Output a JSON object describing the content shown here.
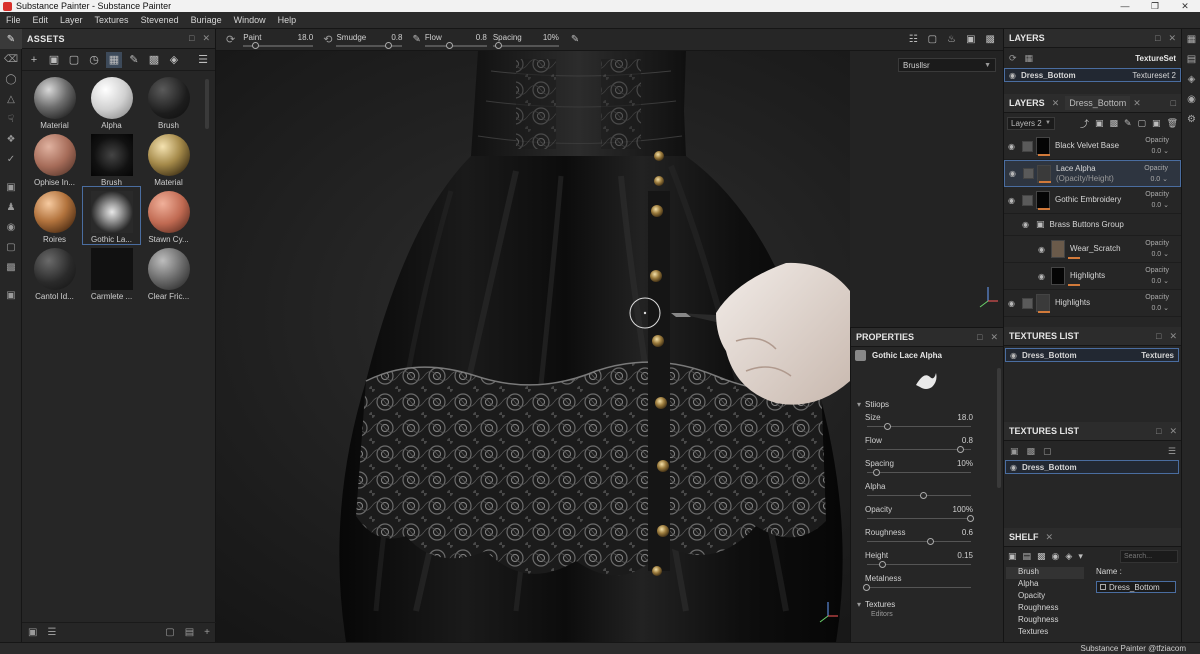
{
  "window": {
    "title": "Substance Painter - Substance Painter"
  },
  "menu": [
    "File",
    "Edit",
    "Layer",
    "Textures",
    "Stevened",
    "Buriage",
    "Window",
    "Help"
  ],
  "assets": {
    "title": "ASSETS",
    "items": [
      {
        "label": "Material",
        "style": "radial-gradient(circle at 35% 30%, #d8d8d8, #6d6d6d 45%, #2a2a2a 80%)"
      },
      {
        "label": "Alpha",
        "style": "radial-gradient(circle at 35% 30%, #ffffff, #d0d0d0 50%, #8a8a8a 90%)"
      },
      {
        "label": "Brush",
        "style": "radial-gradient(circle at 35% 30%, #5a5a5a, #1c1c1c 60%, #0d0d0d)"
      },
      {
        "label": "Ophise In...",
        "style": "radial-gradient(circle at 35% 30%, #e0b2a0, #a66c59 50%, #55352a 90%)"
      },
      {
        "label": "Brush",
        "style": "radial-gradient(circle at 50% 50%, #444, #111 60%, #050505)",
        "square": true
      },
      {
        "label": "Material",
        "style": "radial-gradient(circle at 35% 30%, #f4e2b0, #a58a4a 45%, #3c2e14 85%)"
      },
      {
        "label": "Roires",
        "style": "radial-gradient(circle at 35% 30%, #f6caa0, #b2733d 45%, #4a2a12 85%)"
      },
      {
        "label": "Gothic La...",
        "style": "radial-gradient(circle at 50% 50%, #e8e8e8, #9a9a9a 30%, #2a2a2a 70%)",
        "square": true
      },
      {
        "label": "Stawn Cy...",
        "style": "radial-gradient(circle at 35% 30%, #f0b09a, #c06a52 50%, #5a2c20 90%)"
      },
      {
        "label": "Cantol Id...",
        "style": "radial-gradient(circle at 35% 30%, #6a6a6a, #2a2a2a 55%, #111)"
      },
      {
        "label": "Carmlete ...",
        "style": "linear-gradient(#111, #111)",
        "square": true
      },
      {
        "label": "Clear Fric...",
        "style": "radial-gradient(circle at 35% 30%, #bdbdbd, #6a6a6a 50%, #2a2a2a 90%)"
      }
    ]
  },
  "tool_options": {
    "paint": {
      "label": "Paint",
      "value": "18.0",
      "level": 0.18
    },
    "smudge": {
      "label": "Smudge",
      "value": "0.8",
      "level": 0.8
    },
    "flow": {
      "label": "Flow",
      "value": "0.8",
      "level": 0.4
    },
    "spacing": {
      "label": "Spacing",
      "value": "10%",
      "level": 0.1
    }
  },
  "viewport": {
    "brush_select": "Brusllsr"
  },
  "texture_set": {
    "title": "LAYERS",
    "header_right": "TextureSet",
    "row": {
      "name": "Dress_Bottom",
      "value": "Textureset 2"
    }
  },
  "layers": {
    "tab": "LAYERS",
    "tab2": "Dress_Bottom",
    "dropdown": "Layers 2",
    "opacity_label": "Opacity",
    "items": [
      {
        "name": "Black Velvet Base",
        "sub": "",
        "opacity": "0.0",
        "indent": 0,
        "selected": false,
        "mask": true,
        "thumb": "#050505"
      },
      {
        "name": "Lace Alpha",
        "sub": "(Opacity/Height)",
        "opacity": "0.0",
        "indent": 0,
        "selected": true,
        "mask": true,
        "thumb": "#3a3a3a"
      },
      {
        "name": "Gothic Embroidery",
        "sub": "",
        "opacity": "0.0",
        "indent": 0,
        "selected": false,
        "mask": true,
        "thumb": "#050505"
      },
      {
        "name": "Brass Buttons Group",
        "sub": "",
        "opacity": "",
        "indent": 1,
        "selected": false,
        "group": true
      },
      {
        "name": "Wear_Scratch",
        "sub": "",
        "opacity": "0.0",
        "indent": 2,
        "selected": false,
        "thumb": "#6a5a4a"
      },
      {
        "name": "Highlights",
        "sub": "",
        "opacity": "0.0",
        "indent": 2,
        "selected": false,
        "thumb": "#050505"
      },
      {
        "name": "Highlights",
        "sub": "",
        "opacity": "0.0",
        "indent": 0,
        "selected": false,
        "mask": true,
        "thumb": "#3a3a3a"
      }
    ]
  },
  "textures_list_1": {
    "title": "TEXTURES LIST",
    "row": {
      "name": "Dress_Bottom",
      "value": "Textures"
    }
  },
  "textures_list_2": {
    "title": "TEXTURES LIST",
    "row": {
      "name": "Dress_Bottom"
    }
  },
  "shelf": {
    "title": "SHELF",
    "search_placeholder": "Search...",
    "items": [
      "Brush",
      "Alpha",
      "Opacity",
      "Roughness",
      "Roughness",
      "Textures"
    ],
    "name_label": "Name :",
    "name_value": "Dress_Bottom"
  },
  "properties": {
    "title": "PROPERTIES",
    "brush_name": "Gothic Lace Alpha",
    "section": "Stiiops",
    "rows": [
      {
        "label": "Size",
        "value": "18.0",
        "level": 0.2
      },
      {
        "label": "Flow",
        "value": "0.8",
        "level": 0.9
      },
      {
        "label": "Spacing",
        "value": "10%",
        "level": 0.1
      },
      {
        "label": "Alpha",
        "value": "",
        "level": 0.55
      },
      {
        "label": "Opacity",
        "value": "100%",
        "level": 1.0
      },
      {
        "label": "Roughness",
        "value": "0.6",
        "level": 0.62
      },
      {
        "label": "Height",
        "value": "0.15",
        "level": 0.15
      },
      {
        "label": "Metalness",
        "value": "",
        "level": 0.0
      }
    ],
    "section2": "Textures",
    "section2_item": "Editors"
  },
  "status": {
    "text": "Substance Painter @tfziacom"
  }
}
